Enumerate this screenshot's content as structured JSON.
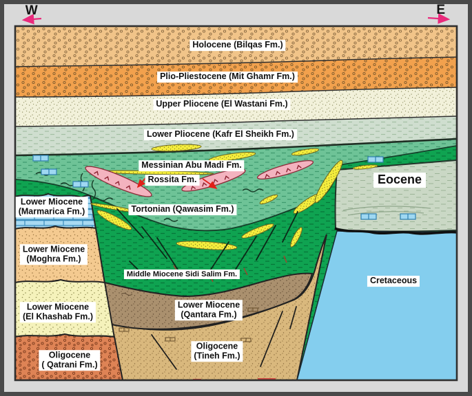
{
  "compass": {
    "west": "W",
    "east": "E"
  },
  "labels": {
    "holocene": "Holocene (Bilqas Fm.)",
    "plio_pleistocene": "Plio-Pliestocene (Mit Ghamr Fm.)",
    "upper_pliocene": "Upper Pliocene (El Wastani Fm.)",
    "lower_pliocene": "Lower Pliocene (Kafr El Sheikh Fm.)",
    "messinian": "Messinian Abu Madi Fm.",
    "rossita": "Rossita Fm.",
    "tortonian": "Tortonian (Qawasim Fm.)",
    "sidi_salim": "Middle Miocene Sidi Salim Fm.",
    "eocene": "Eocene",
    "cretaceous": "Cretaceous",
    "marmarica_1": "Lower Miocene",
    "marmarica_2": "(Marmarica Fm.)",
    "moghra_1": "Lower Miocene",
    "moghra_2": "(Moghra Fm.)",
    "khashab_1": "Lower Miocene",
    "khashab_2": "(El Khashab Fm.)",
    "qatrani_1": "Oligocene",
    "qatrani_2": "( Qatrani Fm.)",
    "qantara_1": "Lower Miocene",
    "qantara_2": "(Qantara Fm.)",
    "tineh_1": "Oligocene",
    "tineh_2": "(Tineh Fm.)"
  },
  "colors": {
    "frame": "#4a4a4a",
    "background": "#d9d9d9",
    "compass_arrow": "#ea2a7c",
    "rossita_arrow": "#e02018",
    "holocene": "#f1c489",
    "plio_pleistocene": "#f2a14d",
    "upper_pliocene": "#f2f1da",
    "lower_pliocene": "#cfdecf",
    "messinian_sage": "#6ec397",
    "basin_dark_green": "#0fa351",
    "eocene": "#cad8c5",
    "cretaceous": "#84ceee",
    "marmarica_limestone": "#a8daf2",
    "moghra": "#f4ca90",
    "el_khashab": "#f5f2bb",
    "qatrani": "#de8355",
    "qantara": "#aa906e",
    "tineh": "#d9b87d",
    "sand_lens_yellow": "#f4ed3d",
    "rossita_pink": "#f3b3bf"
  }
}
